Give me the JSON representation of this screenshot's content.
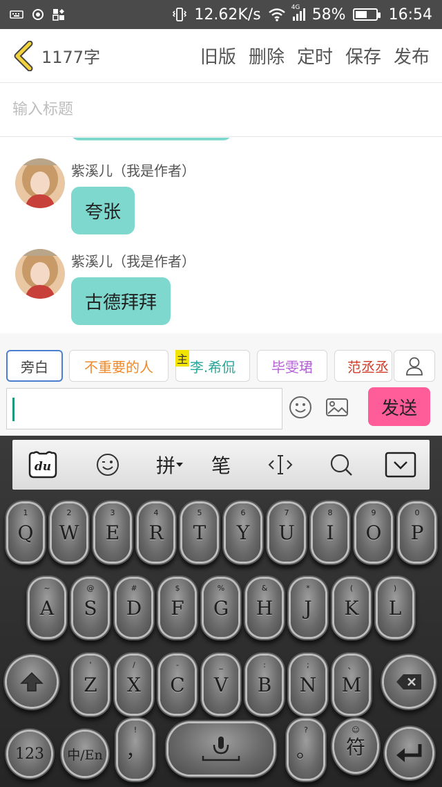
{
  "status_bar": {
    "speed": "12.62K/s",
    "network": "4G",
    "battery": "58%",
    "battery_level": 0.58,
    "time": "16:54"
  },
  "header": {
    "word_count": "1177字",
    "actions": [
      "旧版",
      "删除",
      "定时",
      "保存",
      "发布"
    ]
  },
  "title_input": {
    "placeholder": "输入标题",
    "value": ""
  },
  "messages": [
    {
      "author": "紫溪儿（我是作者）",
      "text": "夸张"
    },
    {
      "author": "紫溪儿（我是作者）",
      "text": "古德拜拜"
    }
  ],
  "roles": {
    "narration": "旁白",
    "items": [
      "不重要的人",
      "李.希侃",
      "毕雯珺",
      "范丞丞"
    ],
    "main_tag": "主",
    "colors": [
      "#ef8a2c",
      "#2aa79b",
      "#b560d6",
      "#d23d2a"
    ]
  },
  "composer": {
    "value": "",
    "send_label": "发送"
  },
  "keyboard": {
    "toolbar": {
      "pinyin": "拼",
      "stroke": "笔",
      "logo": "du"
    },
    "row1": [
      {
        "k": "Q",
        "s": "1"
      },
      {
        "k": "W",
        "s": "2"
      },
      {
        "k": "E",
        "s": "3"
      },
      {
        "k": "R",
        "s": "4"
      },
      {
        "k": "T",
        "s": "5"
      },
      {
        "k": "Y",
        "s": "6"
      },
      {
        "k": "U",
        "s": "7"
      },
      {
        "k": "I",
        "s": "8"
      },
      {
        "k": "O",
        "s": "9"
      },
      {
        "k": "P",
        "s": "0"
      }
    ],
    "row2": [
      {
        "k": "A",
        "s": "~"
      },
      {
        "k": "S",
        "s": "@"
      },
      {
        "k": "D",
        "s": "#"
      },
      {
        "k": "F",
        "s": "$"
      },
      {
        "k": "G",
        "s": "%"
      },
      {
        "k": "H",
        "s": "&"
      },
      {
        "k": "J",
        "s": "*"
      },
      {
        "k": "K",
        "s": "("
      },
      {
        "k": "L",
        "s": ")"
      }
    ],
    "row3": [
      {
        "k": "Z",
        "s": "'"
      },
      {
        "k": "X",
        "s": "/"
      },
      {
        "k": "C",
        "s": "-"
      },
      {
        "k": "V",
        "s": "_"
      },
      {
        "k": "B",
        "s": ":"
      },
      {
        "k": "N",
        "s": ";"
      },
      {
        "k": "M",
        "s": "、"
      }
    ],
    "bottom": {
      "num": "123",
      "lang": "中/En",
      "comma": "，",
      "comma_sub": "!",
      "period": "。",
      "period_sub": "?",
      "symbol": "符"
    }
  }
}
